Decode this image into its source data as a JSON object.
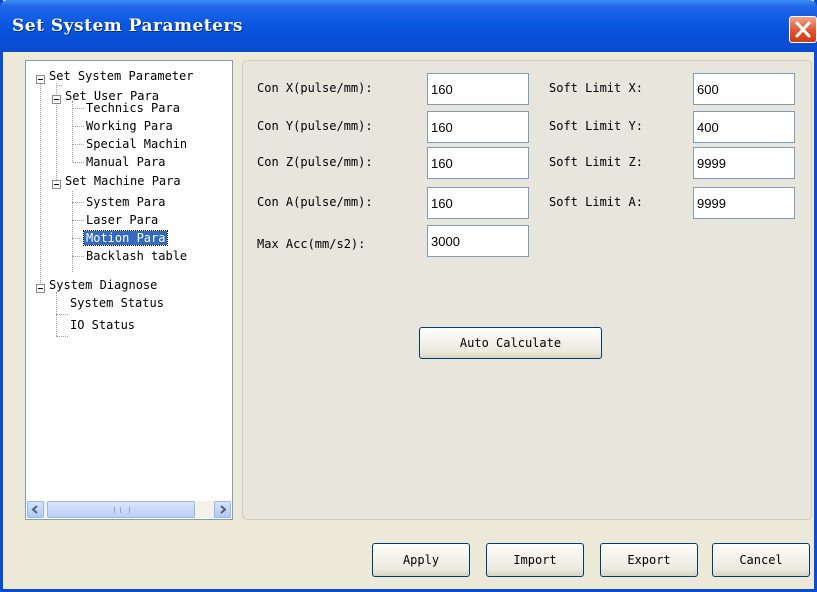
{
  "window": {
    "title": "Set System Parameters"
  },
  "tree": {
    "nodes": [
      {
        "label": "Set System Parameter"
      },
      {
        "label": "Set User Para"
      },
      {
        "label": "Technics Para"
      },
      {
        "label": "Working Para"
      },
      {
        "label": "Special Machin"
      },
      {
        "label": "Manual Para"
      },
      {
        "label": "Set Machine Para"
      },
      {
        "label": "System Para"
      },
      {
        "label": "Laser Para"
      },
      {
        "label": "Motion Para",
        "selected": true
      },
      {
        "label": "Backlash table"
      },
      {
        "label": "System Diagnose"
      },
      {
        "label": "System Status"
      },
      {
        "label": "IO Status"
      }
    ],
    "scrollbar_thumb": "III"
  },
  "params": {
    "con_x": {
      "label": "Con X(pulse/mm):",
      "value": "160"
    },
    "con_y": {
      "label": "Con Y(pulse/mm):",
      "value": "160"
    },
    "con_z": {
      "label": "Con Z(pulse/mm):",
      "value": "160"
    },
    "con_a": {
      "label": "Con A(pulse/mm):",
      "value": "160"
    },
    "max_acc": {
      "label": "Max Acc(mm/s2):",
      "value": "3000"
    },
    "soft_x": {
      "label": "Soft Limit X:",
      "value": "600"
    },
    "soft_y": {
      "label": "Soft Limit Y:",
      "value": "400"
    },
    "soft_z": {
      "label": "Soft Limit Z:",
      "value": "9999"
    },
    "soft_a": {
      "label": "Soft Limit A:",
      "value": "9999"
    },
    "auto_calculate": "Auto Calculate"
  },
  "buttons": {
    "apply": "Apply",
    "import": "Import",
    "export": "Export",
    "cancel": "Cancel"
  },
  "colors": {
    "titlebar": "#0a58e2",
    "selection": "#316ac5",
    "close": "#e0542e"
  }
}
